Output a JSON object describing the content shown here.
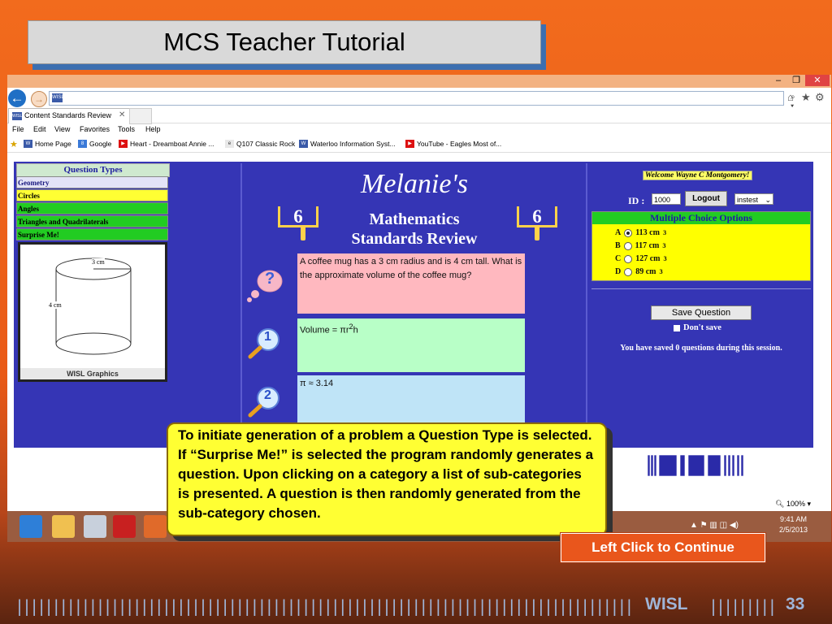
{
  "slide": {
    "title": "MCS Teacher Tutorial",
    "callout_text": " To initiate generation of a problem a Question Type is selected. If “Surprise Me!” is selected the program randomly generates a question. Upon clicking on a category a list of sub-categories is presented. A question is then randomly generated from the sub-category chosen.",
    "continue_label": "Left Click to Continue",
    "footer_brand": "WISL",
    "page_number": "33"
  },
  "browser": {
    "address_favicon": "WISL",
    "tab_label": "Content Standards Review",
    "menu": [
      "File",
      "Edit",
      "View",
      "Favorites",
      "Tools",
      "Help"
    ],
    "favorites": [
      "Home Page",
      "Google",
      "Heart - Dreamboat Annie ...",
      "Q107 Classic Rock",
      "Waterloo Information Syst...",
      "YouTube - Eagles Most of..."
    ],
    "zoom": "100%",
    "clock_time": "9:41 AM",
    "clock_date": "2/5/2013"
  },
  "question_types": {
    "header": "Question Types",
    "items": [
      {
        "label": "Geometry",
        "color": "#e3e3f7"
      },
      {
        "label": "Circles",
        "color": "#ffff33"
      },
      {
        "label": "Angles",
        "color": "#22cc22"
      },
      {
        "label": "Triangles and Quadrilaterals",
        "color": "#22cc22"
      },
      {
        "label": "Surprise Me!",
        "color": "#22cc22"
      }
    ],
    "graphic_radius_label": "3 cm",
    "graphic_height_label": "4 cm",
    "graphic_caption": "WISL Graphics"
  },
  "header": {
    "name": "Melanie's",
    "line2": "Mathematics",
    "line3": "Standards Review",
    "grade_left": "6",
    "grade_right": "6"
  },
  "question": {
    "text": "A coffee mug has a 3 cm radius and is 4 cm tall. What is the approximate volume of the coffee mug?",
    "step1_prefix": "Volume = πr",
    "step1_sup": "2",
    "step1_suffix": "h",
    "step2": "π ≈ 3.14",
    "step1_badge": "1",
    "step2_badge": "2",
    "hint_badge": "?"
  },
  "right": {
    "welcome": "Welcome Wayne C Montgomery!",
    "id_label": "ID :",
    "id_value": "1000",
    "logout_label": "Logout",
    "user_select": "instest",
    "mc_header": "Multiple Choice Options",
    "options": [
      {
        "letter": "A",
        "value": "113 cm",
        "selected": true
      },
      {
        "letter": "B",
        "value": "117 cm",
        "selected": false
      },
      {
        "letter": "C",
        "value": "127 cm",
        "selected": false
      },
      {
        "letter": "D",
        "value": "89 cm",
        "selected": false
      }
    ],
    "unit_sup": "3",
    "save_label": "Save Question",
    "dont_save_label": "Don't save",
    "saved_msg": "You have saved 0 questions during this session."
  }
}
